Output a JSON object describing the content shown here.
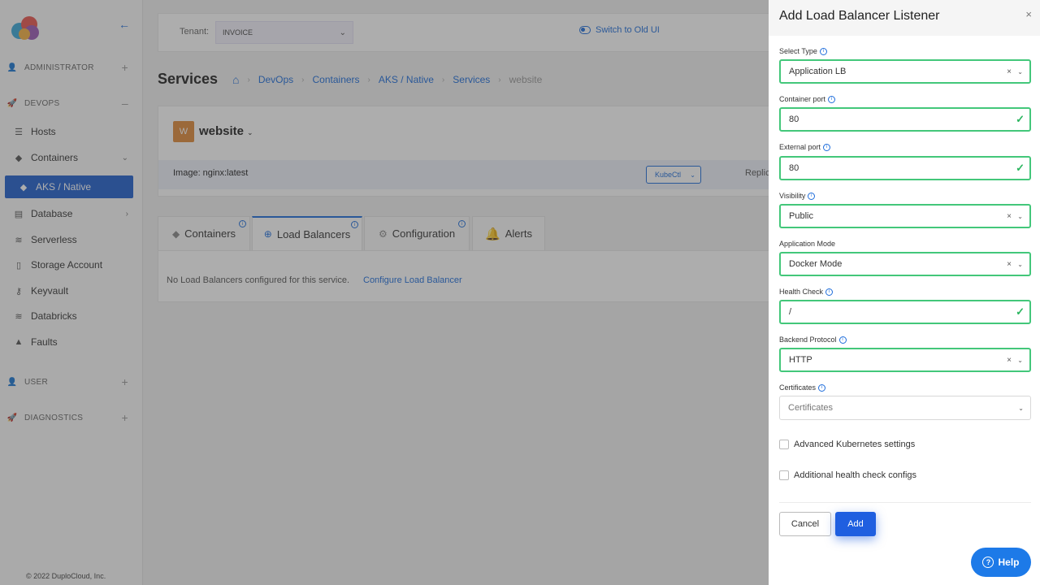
{
  "sidebar": {
    "sections": {
      "administrator": "ADMINISTRATOR",
      "devops": "DEVOPS",
      "user": "USER",
      "diagnostics": "DIAGNOSTICS"
    },
    "items": {
      "hosts": "Hosts",
      "containers": "Containers",
      "aks_native": "AKS / Native",
      "database": "Database",
      "serverless": "Serverless",
      "storage_account": "Storage Account",
      "keyvault": "Keyvault",
      "databricks": "Databricks",
      "faults": "Faults"
    },
    "copyright": "© 2022 DuploCloud, Inc."
  },
  "topbar": {
    "tenant_label": "Tenant:",
    "tenant_value": "INVOICE",
    "switch_ui": "Switch to Old UI"
  },
  "page": {
    "title": "Services",
    "breadcrumb": [
      "DevOps",
      "Containers",
      "AKS / Native",
      "Services",
      "website"
    ]
  },
  "service": {
    "avatar": "W",
    "name": "website",
    "image": "Image: nginx:latest",
    "kubectl": "KubeCtl",
    "replicas": "Replic"
  },
  "tabs": {
    "containers": "Containers",
    "load_balancers": "Load Balancers",
    "configuration": "Configuration",
    "alerts": "Alerts"
  },
  "tab_content": {
    "empty": "No Load Balancers configured for this service.",
    "configure_link": "Configure Load Balancer"
  },
  "drawer": {
    "title": "Add Load Balancer Listener",
    "fields": {
      "select_type": {
        "label": "Select Type",
        "value": "Application LB"
      },
      "container_port": {
        "label": "Container port",
        "value": "80"
      },
      "external_port": {
        "label": "External port",
        "value": "80"
      },
      "visibility": {
        "label": "Visibility",
        "value": "Public"
      },
      "application_mode": {
        "label": "Application Mode",
        "value": "Docker Mode"
      },
      "health_check": {
        "label": "Health Check",
        "value": "/"
      },
      "backend_protocol": {
        "label": "Backend Protocol",
        "value": "HTTP"
      },
      "certificates": {
        "label": "Certificates",
        "placeholder": "Certificates"
      }
    },
    "checkboxes": {
      "advanced_k8s": "Advanced Kubernetes settings",
      "health_configs": "Additional health check configs"
    },
    "cancel_label": "Cancel",
    "add_label": "Add",
    "help_label": "Help"
  },
  "colors": {
    "accent": "#1e6ddb",
    "valid_border": "#43c77a",
    "active_nav": "#1f5fce"
  }
}
